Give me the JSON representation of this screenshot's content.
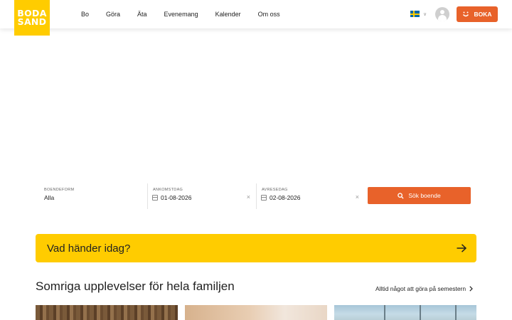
{
  "logo": {
    "line1": "BODA",
    "line2": "SAND"
  },
  "nav": [
    {
      "label": "Bo"
    },
    {
      "label": "Göra"
    },
    {
      "label": "Äta"
    },
    {
      "label": "Evenemang"
    },
    {
      "label": "Kalender"
    },
    {
      "label": "Om oss"
    }
  ],
  "header": {
    "language_icon": "sweden-flag-icon",
    "cta_label": "BOKA"
  },
  "search": {
    "boendeform_label": "BOENDEFORM",
    "boendeform_value": "Alla",
    "ankomst_label": "ANKOMSTDAG",
    "ankomst_value": "01-08-2026",
    "avrese_label": "AVRESEDAG",
    "avrese_value": "02-08-2026",
    "clear_symbol": "×",
    "button_label": "Sök boende"
  },
  "banner": {
    "text": "Vad händer idag?"
  },
  "section": {
    "title": "Somriga upplevelser för hela familjen",
    "link_label": "Alltid något att göra på semestern"
  },
  "colors": {
    "brand_yellow": "#FFCC00",
    "accent_orange": "#E8622A"
  }
}
